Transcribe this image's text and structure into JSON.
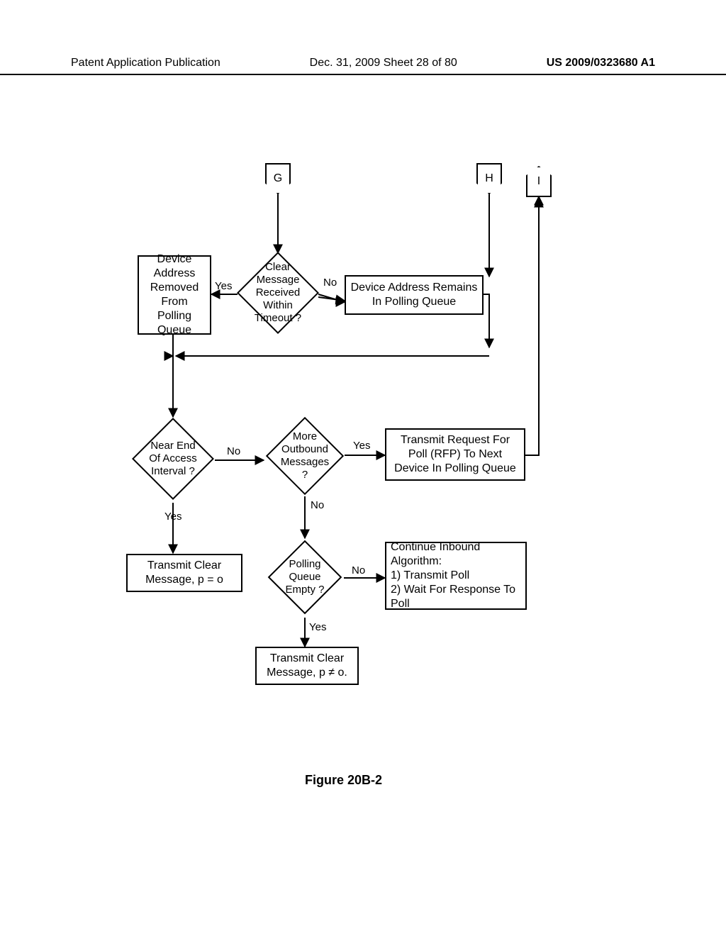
{
  "header": {
    "left": "Patent Application Publication",
    "center": "Dec. 31, 2009  Sheet 28 of 80",
    "right": "US 2009/0323680 A1"
  },
  "connectors": {
    "g": "G",
    "h": "H",
    "i": "I"
  },
  "nodes": {
    "clear_msg_decision": "Clear Message Received Within Timeout ?",
    "addr_removed": "Device Address Removed From Polling Queue",
    "addr_remains": "Device Address Remains In Polling Queue",
    "near_end_decision": "Near End Of Access Interval ?",
    "more_outbound_decision": "More Outbound Messages ?",
    "tx_rfp": "Transmit Request For Poll (RFP) To Next Device In Polling Queue",
    "tx_clear_p0": "Transmit Clear Message, p = o",
    "polling_empty_decision": "Polling Queue Empty ?",
    "continue_inbound": "Continue Inbound Algorithm:\n1) Transmit Poll\n2) Wait For Response To Poll",
    "tx_clear_pnz": "Transmit Clear Message, p ≠ o."
  },
  "edge_labels": {
    "yes": "Yes",
    "no": "No"
  },
  "figure": "Figure 20B-2"
}
